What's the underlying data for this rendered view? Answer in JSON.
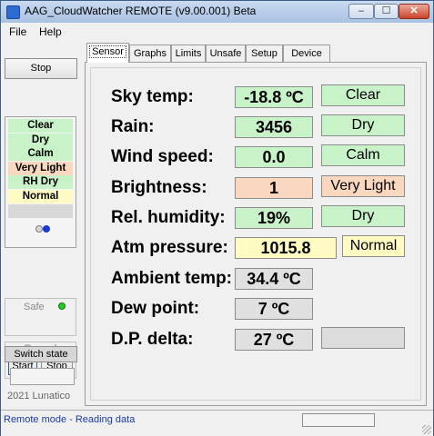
{
  "window": {
    "title": "AAG_CloudWatcher REMOTE (v9.00.001) Beta",
    "min_glyph": "–",
    "max_glyph": "☐",
    "close_glyph": "✕"
  },
  "menu": {
    "file": "File",
    "help": "Help"
  },
  "sidebar": {
    "stop_label": "Stop",
    "conditions": [
      {
        "label": "Clear",
        "color": "#c8f2c8"
      },
      {
        "label": "Dry",
        "color": "#c8f2c8"
      },
      {
        "label": "Calm",
        "color": "#c8f2c8"
      },
      {
        "label": "Very Light",
        "color": "#fad7bf"
      },
      {
        "label": "RH Dry",
        "color": "#c8f2c8"
      },
      {
        "label": "Normal",
        "color": "#fffbc2"
      }
    ],
    "safe_label": "Safe",
    "safe_led_color": "#22cc22",
    "record_label": "Record",
    "record_start_label": "Start",
    "record_stop_label": "Stop",
    "switch_state_label": "Switch state",
    "copyright": "2021 Lunatico"
  },
  "tabs": [
    "Sensor",
    "Graphs",
    "Limits",
    "Unsafe",
    "Setup",
    "Device"
  ],
  "active_tab": "Sensor",
  "readings": [
    {
      "label": "Sky temp:",
      "value": "-18.8 ºC",
      "value_color": "#c8f2c8",
      "status": "Clear",
      "status_color": "#c8f2c8"
    },
    {
      "label": "Rain:",
      "value": "3456",
      "value_color": "#c8f2c8",
      "status": "Dry",
      "status_color": "#c8f2c8"
    },
    {
      "label": "Wind speed:",
      "value": "0.0",
      "value_color": "#c8f2c8",
      "status": "Calm",
      "status_color": "#c8f2c8"
    },
    {
      "label": "Brightness:",
      "value": "1",
      "value_color": "#fad7bf",
      "status": "Very Light",
      "status_color": "#fad7bf"
    },
    {
      "label": "Rel. humidity:",
      "value": "19%",
      "value_color": "#c8f2c8",
      "status": "Dry",
      "status_color": "#c8f2c8"
    },
    {
      "label": "Atm pressure:",
      "value": "1015.8",
      "value_color": "#fffbc2",
      "status": "Normal",
      "status_color": "#fffbc2"
    },
    {
      "label": "Ambient temp:",
      "value": "34.4 ºC",
      "value_color": "#e0e0e0",
      "status": null,
      "status_color": null
    },
    {
      "label": "Dew point:",
      "value": "7 ºC",
      "value_color": "#e0e0e0",
      "status": null,
      "status_color": null
    },
    {
      "label": "D.P. delta:",
      "value": "27 ºC",
      "value_color": "#e0e0e0",
      "status": "",
      "status_color": "#dcdcdc"
    }
  ],
  "statusbar": {
    "text": "Remote mode - Reading data"
  }
}
